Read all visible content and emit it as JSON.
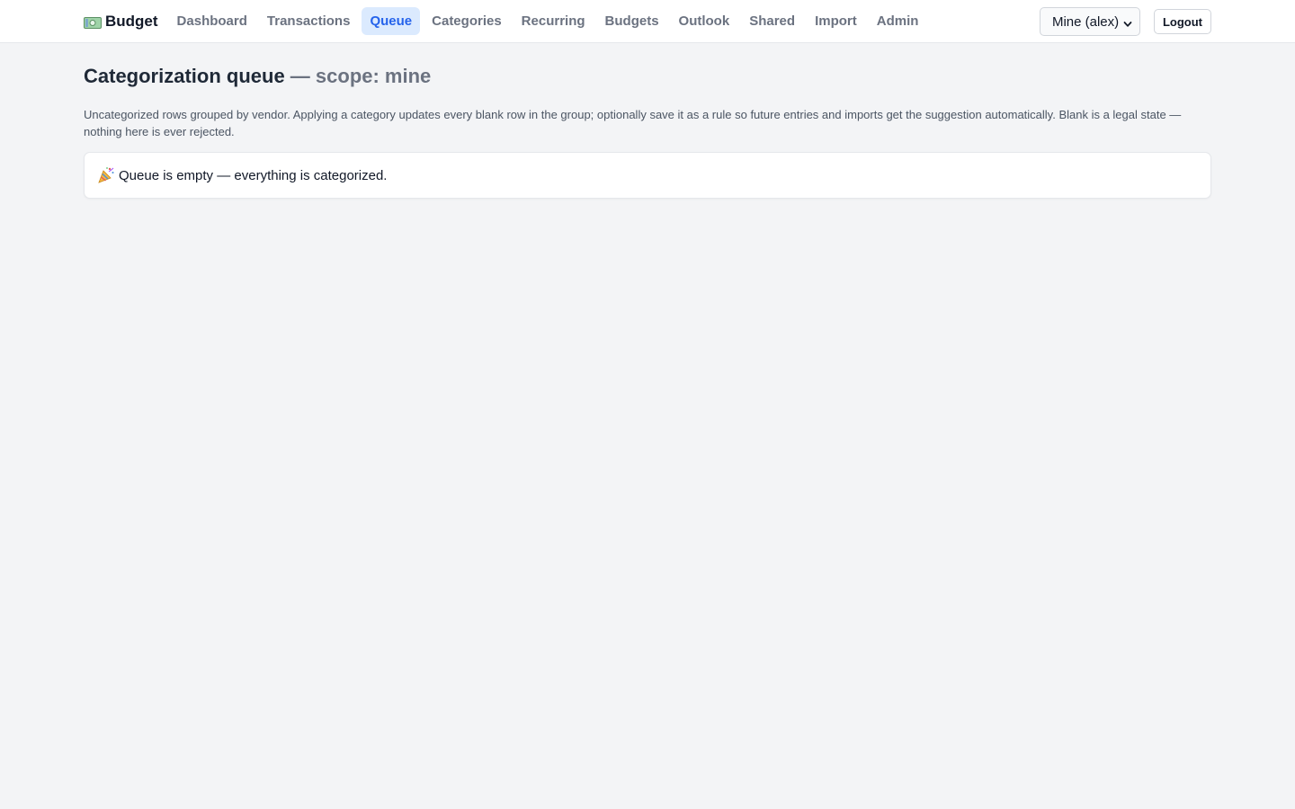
{
  "brand": {
    "icon": "money-icon",
    "name": "Budget"
  },
  "nav": {
    "items": [
      {
        "label": "Dashboard"
      },
      {
        "label": "Transactions"
      },
      {
        "label": "Queue"
      },
      {
        "label": "Categories"
      },
      {
        "label": "Recurring"
      },
      {
        "label": "Budgets"
      },
      {
        "label": "Outlook"
      },
      {
        "label": "Shared"
      },
      {
        "label": "Import"
      },
      {
        "label": "Admin"
      }
    ],
    "active": "Queue"
  },
  "scope_select": {
    "value": "Mine (alex)"
  },
  "logout": {
    "label": "Logout"
  },
  "page": {
    "title": "Categorization queue",
    "scope_suffix": " — scope: mine",
    "description": "Uncategorized rows grouped by vendor. Applying a category updates every blank row in the group; optionally save it as a rule so future entries and imports get the suggestion automatically. Blank is a legal state — nothing here is ever rejected.",
    "empty_message": "Queue is empty — everything is categorized.",
    "empty_icon": "party-popper-icon"
  },
  "colors": {
    "accent": "#2563eb",
    "accent_bg": "#dbeafe",
    "page_bg": "#f3f4f6"
  }
}
